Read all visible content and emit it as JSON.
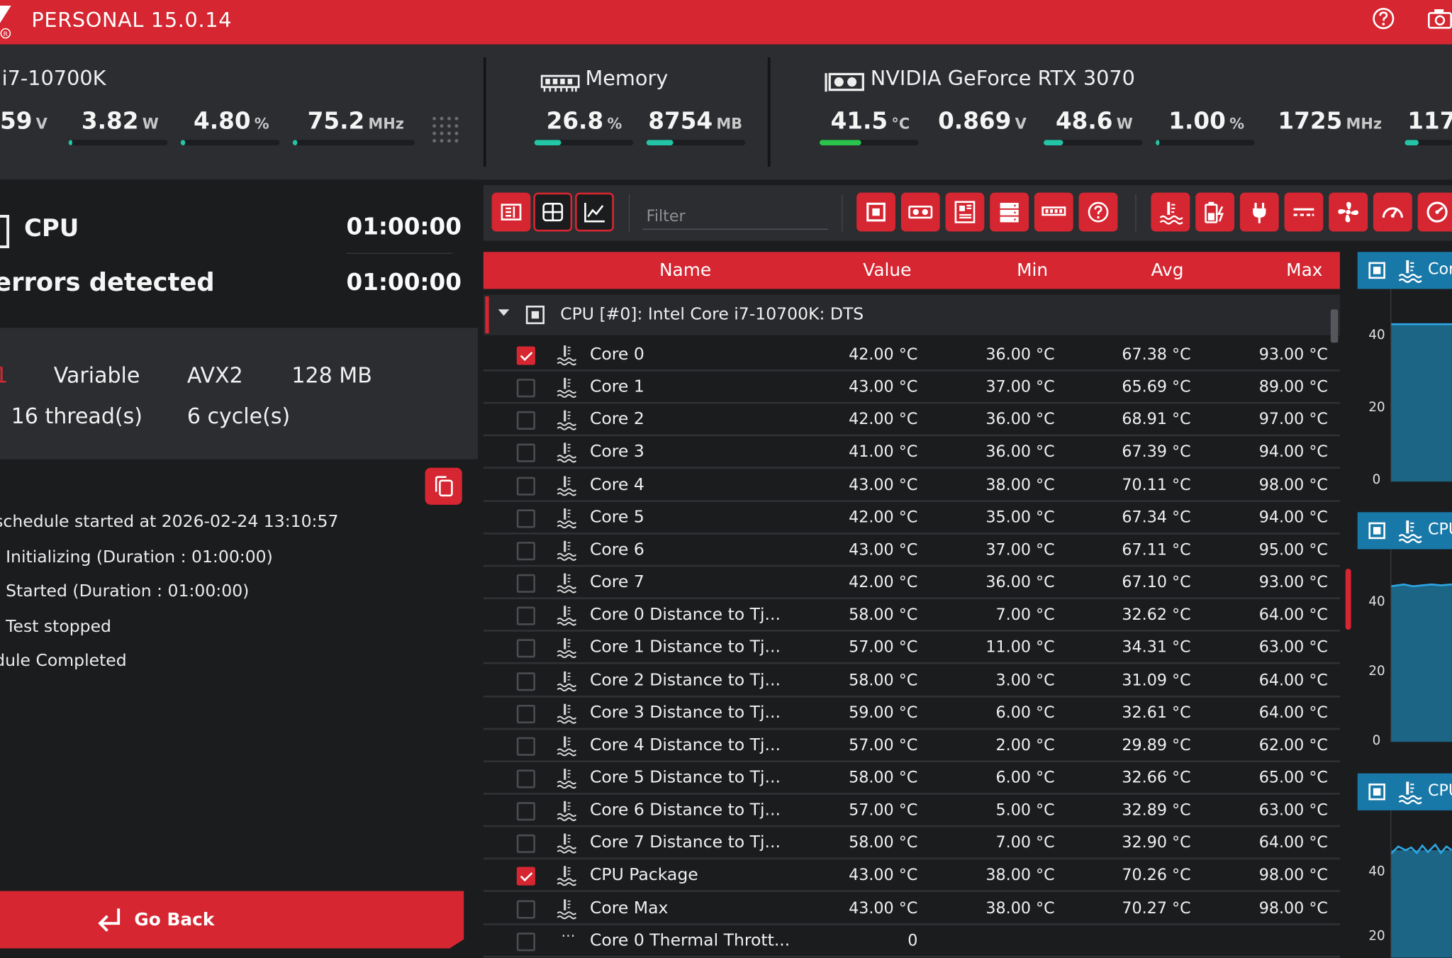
{
  "app": {
    "title": "PERSONAL 15.0.14",
    "colors": {
      "accent": "#d52631",
      "graph_header": "#1878a8",
      "bar_teal": "#22c5a5",
      "bar_green": "#2ac34c",
      "panel": "#2b2d31",
      "background": "#1b1c1e"
    },
    "icons": [
      "help-icon",
      "camera-icon"
    ]
  },
  "cpu_stats": {
    "name": "i7-10700K",
    "metrics": [
      {
        "value": "59",
        "unit": "V"
      },
      {
        "value": "3.82",
        "unit": "W",
        "level": 0.04
      },
      {
        "value": "4.80",
        "unit": "%",
        "level": 0.05
      },
      {
        "value": "75.2",
        "unit": "MHz",
        "level": 0.02
      }
    ]
  },
  "memory_stats": {
    "name": "Memory",
    "metrics": [
      {
        "value": "26.8",
        "unit": "%",
        "level": 0.27
      },
      {
        "value": "8754",
        "unit": "MB",
        "level": 0.27
      }
    ]
  },
  "gpu_stats": {
    "name": "NVIDIA GeForce RTX 3070",
    "metrics": [
      {
        "value": "41.5",
        "unit": "°C",
        "level": 0.42
      },
      {
        "value": "0.869",
        "unit": "V"
      },
      {
        "value": "48.6",
        "unit": "W",
        "level": 0.2
      },
      {
        "value": "1.00",
        "unit": "%",
        "level": 0.01
      },
      {
        "value": "1725",
        "unit": "MHz"
      },
      {
        "value": "117",
        "unit": "",
        "level": 0.1
      }
    ]
  },
  "test": {
    "device": "CPU",
    "elapsed": "01:00:00",
    "status": "errors detected",
    "status_time": "01:00:00",
    "info": {
      "mode": "Variable",
      "instruction": "AVX2",
      "data_size": "128 MB",
      "threads": "16 thread(s)",
      "cycles": "6 cycle(s)"
    },
    "log": [
      "schedule started at 2026-02-24 13:10:57",
      "- Initializing (Duration : 01:00:00)",
      "- Started (Duration : 01:00:00)",
      "- Test stopped",
      "dule Completed"
    ],
    "go_back_label": "Go Back"
  },
  "toolbar": {
    "filter_placeholder": "Filter",
    "view_icons": [
      "list-view-icon",
      "grid-view-icon",
      "chart-view-icon"
    ],
    "category_icons": [
      "cpu-icon",
      "gpu-icon",
      "motherboard-icon",
      "storage-icon",
      "memory-icon",
      "help-icon"
    ],
    "sensor_icons": [
      "temperature-icon",
      "battery-icon",
      "power-plug-icon",
      "voltage-icon",
      "fan-icon",
      "speedometer-icon",
      "gauge-icon"
    ]
  },
  "table": {
    "headers": {
      "name": "Name",
      "value": "Value",
      "min": "Min",
      "avg": "Avg",
      "max": "Max"
    },
    "group": "CPU [#0]: Intel Core i7-10700K: DTS",
    "rows": [
      {
        "checked": true,
        "icon": "temperature-icon",
        "name": "Core 0",
        "value": "42.00 °C",
        "min": "36.00 °C",
        "avg": "67.38 °C",
        "max": "93.00 °C"
      },
      {
        "checked": false,
        "icon": "temperature-icon",
        "name": "Core 1",
        "value": "43.00 °C",
        "min": "37.00 °C",
        "avg": "65.69 °C",
        "max": "89.00 °C"
      },
      {
        "checked": false,
        "icon": "temperature-icon",
        "name": "Core 2",
        "value": "42.00 °C",
        "min": "36.00 °C",
        "avg": "68.91 °C",
        "max": "97.00 °C"
      },
      {
        "checked": false,
        "icon": "temperature-icon",
        "name": "Core 3",
        "value": "41.00 °C",
        "min": "36.00 °C",
        "avg": "67.39 °C",
        "max": "94.00 °C"
      },
      {
        "checked": false,
        "icon": "temperature-icon",
        "name": "Core 4",
        "value": "43.00 °C",
        "min": "38.00 °C",
        "avg": "70.11 °C",
        "max": "98.00 °C"
      },
      {
        "checked": false,
        "icon": "temperature-icon",
        "name": "Core 5",
        "value": "42.00 °C",
        "min": "35.00 °C",
        "avg": "67.34 °C",
        "max": "94.00 °C"
      },
      {
        "checked": false,
        "icon": "temperature-icon",
        "name": "Core 6",
        "value": "43.00 °C",
        "min": "37.00 °C",
        "avg": "67.11 °C",
        "max": "95.00 °C"
      },
      {
        "checked": false,
        "icon": "temperature-icon",
        "name": "Core 7",
        "value": "42.00 °C",
        "min": "36.00 °C",
        "avg": "67.10 °C",
        "max": "93.00 °C"
      },
      {
        "checked": false,
        "icon": "temperature-icon",
        "name": "Core 0 Distance to Tj...",
        "value": "58.00 °C",
        "min": "7.00 °C",
        "avg": "32.62 °C",
        "max": "64.00 °C"
      },
      {
        "checked": false,
        "icon": "temperature-icon",
        "name": "Core 1 Distance to Tj...",
        "value": "57.00 °C",
        "min": "11.00 °C",
        "avg": "34.31 °C",
        "max": "63.00 °C"
      },
      {
        "checked": false,
        "icon": "temperature-icon",
        "name": "Core 2 Distance to Tj...",
        "value": "58.00 °C",
        "min": "3.00 °C",
        "avg": "31.09 °C",
        "max": "64.00 °C"
      },
      {
        "checked": false,
        "icon": "temperature-icon",
        "name": "Core 3 Distance to Tj...",
        "value": "59.00 °C",
        "min": "6.00 °C",
        "avg": "32.61 °C",
        "max": "64.00 °C"
      },
      {
        "checked": false,
        "icon": "temperature-icon",
        "name": "Core 4 Distance to Tj...",
        "value": "57.00 °C",
        "min": "2.00 °C",
        "avg": "29.89 °C",
        "max": "62.00 °C"
      },
      {
        "checked": false,
        "icon": "temperature-icon",
        "name": "Core 5 Distance to Tj...",
        "value": "58.00 °C",
        "min": "6.00 °C",
        "avg": "32.66 °C",
        "max": "65.00 °C"
      },
      {
        "checked": false,
        "icon": "temperature-icon",
        "name": "Core 6 Distance to Tj...",
        "value": "57.00 °C",
        "min": "5.00 °C",
        "avg": "32.89 °C",
        "max": "63.00 °C"
      },
      {
        "checked": false,
        "icon": "temperature-icon",
        "name": "Core 7 Distance to Tj...",
        "value": "58.00 °C",
        "min": "7.00 °C",
        "avg": "32.90 °C",
        "max": "64.00 °C"
      },
      {
        "checked": true,
        "icon": "temperature-icon",
        "name": "CPU Package",
        "value": "43.00 °C",
        "min": "38.00 °C",
        "avg": "70.26 °C",
        "max": "98.00 °C"
      },
      {
        "checked": false,
        "icon": "temperature-icon",
        "name": "Core Max",
        "value": "43.00 °C",
        "min": "38.00 °C",
        "avg": "70.27 °C",
        "max": "98.00 °C"
      },
      {
        "checked": false,
        "icon": "more-icon",
        "name": "Core 0 Thermal Thrott...",
        "value": "0",
        "min": "",
        "avg": "",
        "max": ""
      }
    ]
  },
  "graphs": [
    {
      "label": "Cor",
      "yticks": [
        "40",
        "20",
        "0"
      ]
    },
    {
      "label": "CPU",
      "yticks": [
        "40",
        "20",
        "0"
      ]
    },
    {
      "label": "CPU",
      "yticks": [
        "40",
        "20"
      ]
    }
  ]
}
